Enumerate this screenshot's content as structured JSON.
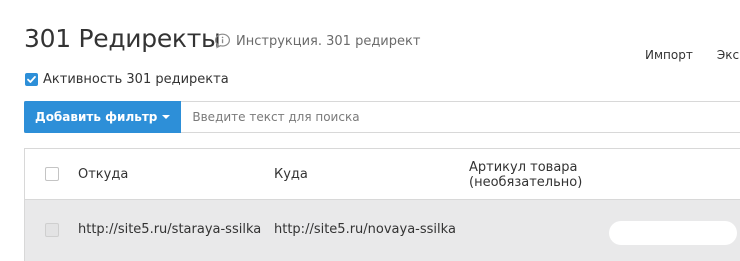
{
  "header": {
    "title": "301 Редиректы",
    "help_link": "Инструкция. 301 редирект",
    "actions": [
      "Импорт",
      "Эксп"
    ]
  },
  "activity": {
    "label": "Активность 301 редиректа",
    "checked": true
  },
  "filter": {
    "add_filter_label": "Добавить фильтр",
    "search_placeholder": "Введите текст для поиска"
  },
  "table": {
    "columns": {
      "from": "Откуда",
      "to": "Куда",
      "article": "Артикул товара (необязательно)"
    },
    "rows": [
      {
        "from": "http://site5.ru/staraya-ssilka",
        "to": "http://site5.ru/novaya-ssilka",
        "article": ""
      }
    ]
  },
  "colors": {
    "accent": "#2d8fd8",
    "row_background": "#e9e9ea",
    "border": "#d8d8d8"
  }
}
